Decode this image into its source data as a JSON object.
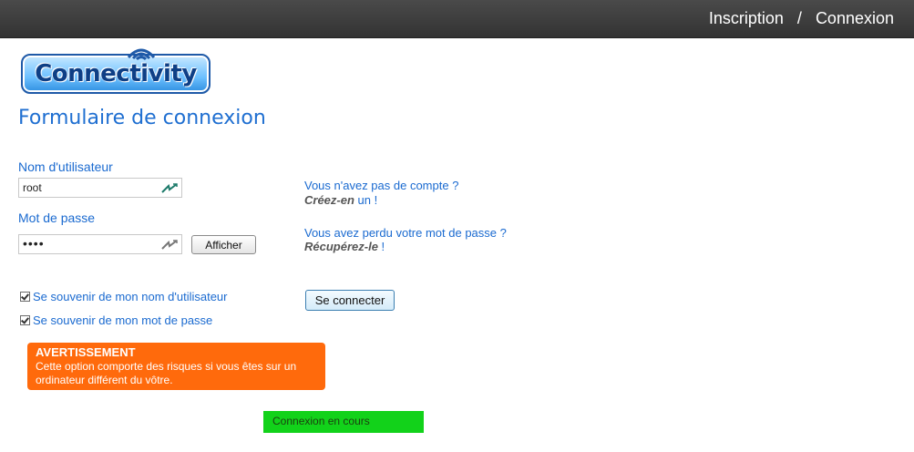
{
  "nav": {
    "register": "Inscription",
    "separator": "/",
    "login": "Connexion"
  },
  "logo": {
    "text": "Connectivity",
    "icon": "wifi-icon"
  },
  "form": {
    "title": "Formulaire de connexion",
    "username_label": "Nom d'utilisateur",
    "username_value": "root",
    "password_label": "Mot de passe",
    "password_value": "root",
    "show_button": "Afficher",
    "remember_username": "Se souvenir de mon nom d'utilisateur",
    "remember_password": "Se souvenir de mon mot de passe",
    "submit_button": "Se connecter"
  },
  "help": {
    "no_account_question": "Vous n'avez pas de compte ?",
    "create_emph": "Créez-en",
    "create_rest": " un !",
    "lost_password_question": "Vous avez perdu votre mot de passe ?",
    "recover_emph": "Récupérez-le",
    "recover_rest": " !"
  },
  "warning": {
    "title": "AVERTISSEMENT",
    "text": "Cette option comporte des risques si vous êtes sur un ordinateur différent du vôtre."
  },
  "status": "Connexion en cours",
  "colors": {
    "topbar": "#3d3d3d",
    "accent_blue": "#1a6ad0",
    "warning_orange": "#ff6a0c",
    "status_green": "#12d21a"
  }
}
